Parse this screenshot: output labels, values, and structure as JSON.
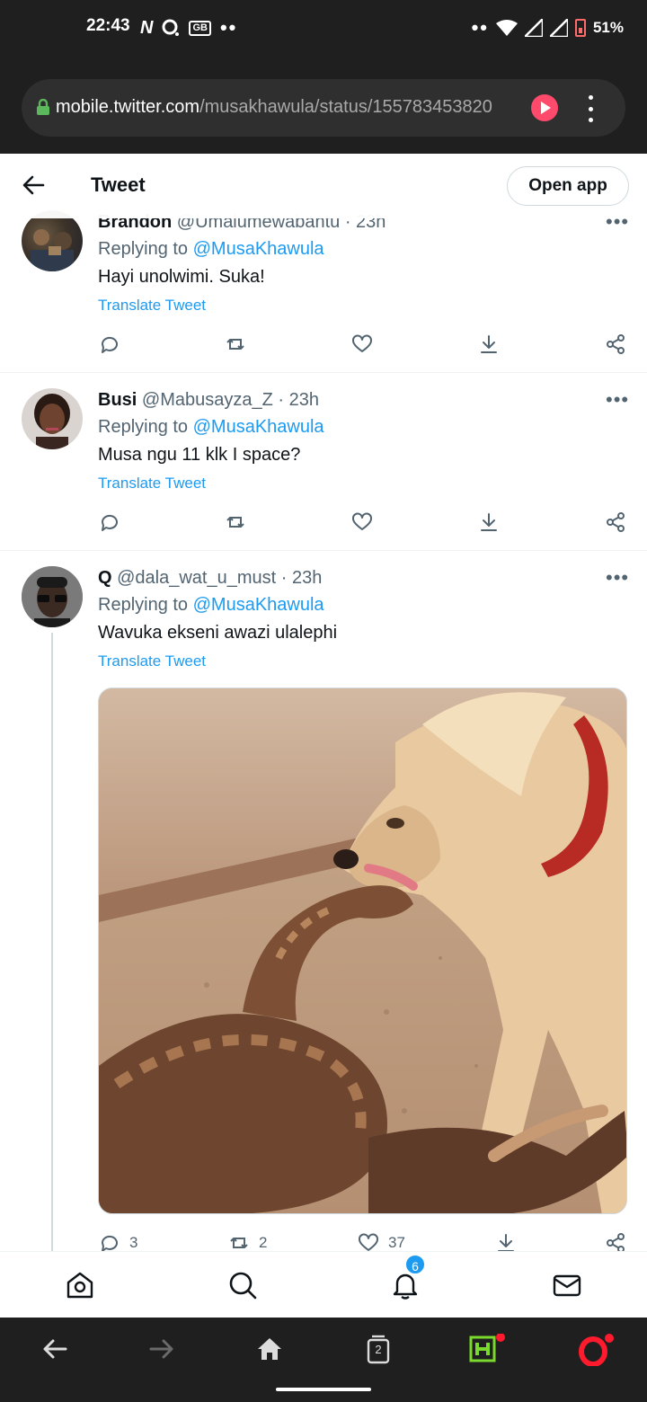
{
  "status_bar": {
    "time": "22:43",
    "left_icons": [
      "netflix-n-icon",
      "chat-bubble-icon",
      "gb-icon",
      "more-dots-icon"
    ],
    "gb_label": "GB",
    "battery": "51%"
  },
  "browser": {
    "url_domain": "mobile.twitter.com",
    "url_path": "/musakhawula/status/155783453820"
  },
  "header": {
    "title": "Tweet",
    "open_app": "Open app"
  },
  "tweets": [
    {
      "name": "Brandon",
      "handle": "@Umalumewabantu",
      "time": "· 23h",
      "replying_label": "Replying to ",
      "replying_to": "@MusaKhawula",
      "text": "Hayi unolwimi. Suka!",
      "translate": "Translate Tweet"
    },
    {
      "name": "Busi",
      "handle": "@Mabusayza_Z",
      "time": "· 23h",
      "replying_label": "Replying to ",
      "replying_to": "@MusaKhawula",
      "text": "Musa ngu 11 klk I space?",
      "translate": "Translate Tweet"
    },
    {
      "name": "Q",
      "handle": "@dala_wat_u_must",
      "time": "· 23h",
      "replying_label": "Replying to ",
      "replying_to": "@MusaKhawula",
      "text": "Wavuka ekseni awazi ulalephi",
      "translate": "Translate Tweet",
      "counts": {
        "replies": "3",
        "retweets": "2",
        "likes": "37"
      }
    }
  ],
  "bottom_nav": {
    "notifications_badge": "6",
    "tabs_count": "2"
  },
  "colors": {
    "link_blue": "#1d9bf0",
    "text_primary": "#0f1419",
    "text_secondary": "#536471",
    "opera_red": "#ff1b2d"
  }
}
